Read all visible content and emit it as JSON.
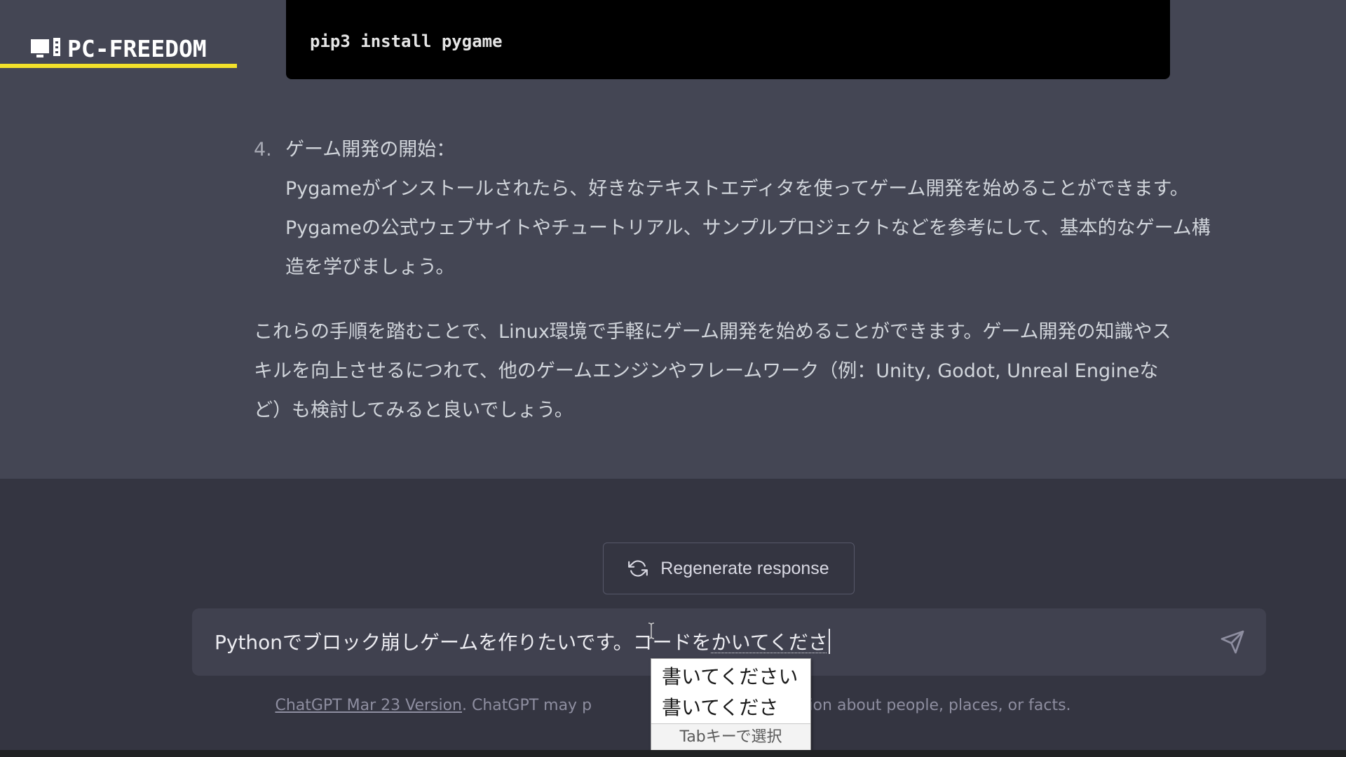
{
  "logo": {
    "text": "PC-FREEDOM"
  },
  "code_block": {
    "code": "pip3 install pygame"
  },
  "response": {
    "list_item": {
      "number": "4.",
      "title": "ゲーム開発の開始：",
      "body_lines": [
        "Pygameがインストールされたら、好きなテキストエディタを使ってゲーム開発を始めることができます。",
        "Pygameの公式ウェブサイトやチュートリアル、サンプルプロジェクトなどを参考にして、基本的なゲーム構",
        "造を学びましょう。"
      ]
    },
    "paragraph_lines": [
      "これらの手順を踏むことで、Linux環境で手軽にゲーム開発を始めることができます。ゲーム開発の知識やス",
      "キルを向上させるにつれて、他のゲームエンジンやフレームワーク（例：Unity, Godot, Unreal Engineな",
      "ど）も検討してみると良いでしょう。"
    ]
  },
  "regenerate": {
    "label": "Regenerate response",
    "icon": "refresh-icon"
  },
  "input": {
    "text_committed": "Pythonでブロック崩しゲームを作りたいです。コードを",
    "text_composing": "かいてくださ",
    "send_icon": "paper-plane-icon"
  },
  "ime": {
    "candidates": [
      "書いてください",
      "書いてくださ"
    ],
    "hint": "Tabキーで選択"
  },
  "footer": {
    "link_text": "ChatGPT Mar 23 Version",
    "text_before_popup": ". ChatGPT may p",
    "text_after_popup": "formation about people, places, or facts."
  },
  "colors": {
    "response_bg": "#444654",
    "page_bg": "#343541",
    "input_bg": "#40414f",
    "logo_accent": "#f2e12a"
  }
}
